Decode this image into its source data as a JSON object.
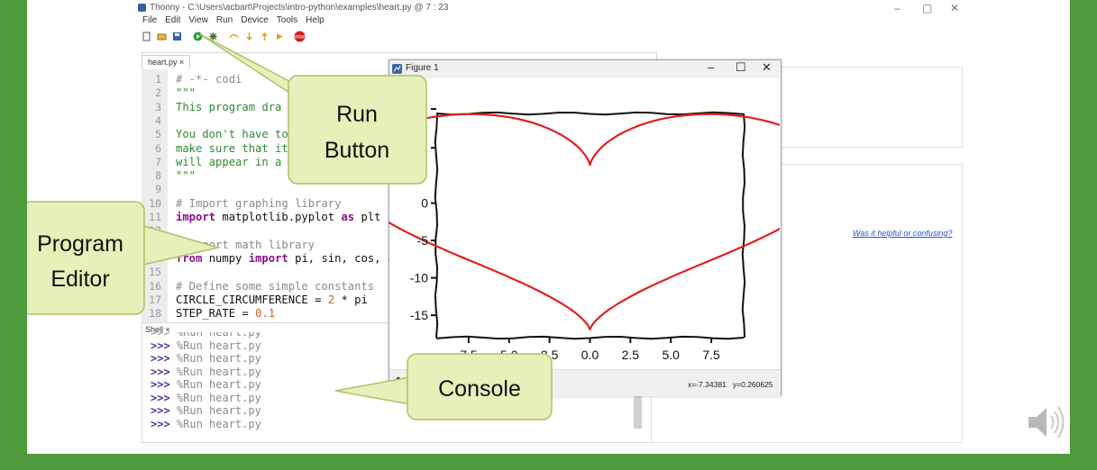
{
  "window": {
    "title": "Thonny - C:\\Users\\acbart\\Projects\\intro-python\\examples\\heart.py @ 7 : 23",
    "controls": [
      "–",
      "▢",
      "✕"
    ]
  },
  "menu": [
    "File",
    "Edit",
    "View",
    "Run",
    "Device",
    "Tools",
    "Help"
  ],
  "toolbar": {
    "icons": [
      "new-file-icon",
      "open-file-icon",
      "save-icon",
      "run-icon",
      "debug-icon",
      "step-over-icon",
      "step-into-icon",
      "step-out-icon",
      "resume-icon",
      "stop-icon"
    ],
    "stop_label": "STOP"
  },
  "editor": {
    "tab_label": "heart.py ×",
    "lines": [
      {
        "n": "1",
        "text": "# -*- codi"
      },
      {
        "n": "2",
        "text": "\"\"\""
      },
      {
        "n": "3",
        "text": "This program dra"
      },
      {
        "n": "4",
        "text": ""
      },
      {
        "n": "5",
        "text": "You don't have to"
      },
      {
        "n": "6",
        "text": "make sure that it"
      },
      {
        "n": "7",
        "text": "will appear in a n"
      },
      {
        "n": "8",
        "text": "\"\"\""
      },
      {
        "n": "9",
        "text": ""
      },
      {
        "n": "10",
        "text": "# Import graphing library"
      },
      {
        "n": "11",
        "kw": "import",
        "text": " matplotlib.pyplot ",
        "kw2": "as",
        "text2": " plt"
      },
      {
        "n": "12",
        "text": ""
      },
      {
        "n": "13",
        "text": "# Import math library"
      },
      {
        "n": "14",
        "kw": "from",
        "text": " numpy ",
        "kw2": "import",
        "text2": " pi, sin, cos, ara"
      },
      {
        "n": "15",
        "text": ""
      },
      {
        "n": "16",
        "text": "# Define some simple constants"
      },
      {
        "n": "17",
        "text": "CIRCLE_CIRCUMFERENCE = ",
        "num": "2",
        "text2": " * pi"
      },
      {
        "n": "18",
        "text": "STEP_RATE = ",
        "num": "0.1"
      }
    ]
  },
  "shell": {
    "label": "Shell ×",
    "prompt": ">>>",
    "partial_line": ">>> %Run heart.py",
    "command": " %Run heart.py",
    "count": 7
  },
  "right_panel": {
    "helpful_link": "Was it helpful or confusing?"
  },
  "figure_window": {
    "title": "Figure 1",
    "controls": [
      "–",
      "☐",
      "✕"
    ],
    "status": "x=-7.34381   y=0.260625",
    "home_icon": "home-icon"
  },
  "chart_data": {
    "type": "line",
    "series": [
      {
        "shape": "heart",
        "color": "#e02020"
      }
    ],
    "x_ticks": [
      "7.5",
      "5.0",
      "2.5",
      "0.0",
      "2.5",
      "5.0",
      "7.5"
    ],
    "y_ticks": [
      "0",
      "-5",
      "-10",
      "-15"
    ],
    "xlim": [
      -9.5,
      9.5
    ],
    "ylim": [
      -18,
      12
    ],
    "style": "xkcd"
  },
  "callouts": {
    "run_button": [
      "Run",
      "Button"
    ],
    "program_editor": [
      "Program",
      "Editor"
    ],
    "console": "Console"
  },
  "colors": {
    "slide_border": "#4f9a3a",
    "callout_fill": "#e6f0b8",
    "callout_stroke": "#a9c36a",
    "heart": "#e02020",
    "stop": "#d02020",
    "run": "#2a9a3a"
  },
  "sound_icon": "speaker-icon"
}
